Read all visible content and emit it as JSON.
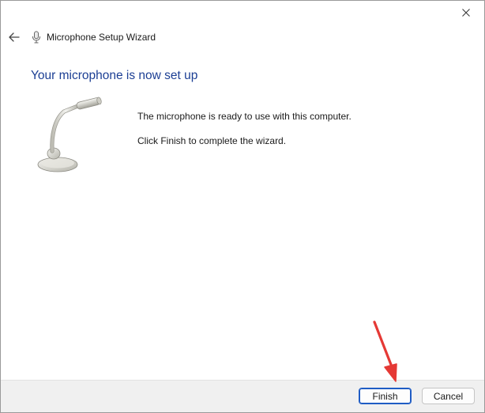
{
  "window": {
    "title": "Microphone Setup Wizard"
  },
  "wizard": {
    "heading": "Your microphone is now set up",
    "message_1": "The microphone is ready to use with this computer.",
    "message_2": "Click Finish to complete the wizard."
  },
  "footer": {
    "finish_label": "Finish",
    "cancel_label": "Cancel"
  },
  "colors": {
    "heading": "#1c3f94",
    "default_button_border": "#1f5cc4",
    "annotation_arrow": "#e53935"
  },
  "icons": {
    "back": "back-arrow-icon",
    "title": "microphone-icon",
    "close": "close-icon",
    "illustration": "desk-microphone-icon"
  }
}
